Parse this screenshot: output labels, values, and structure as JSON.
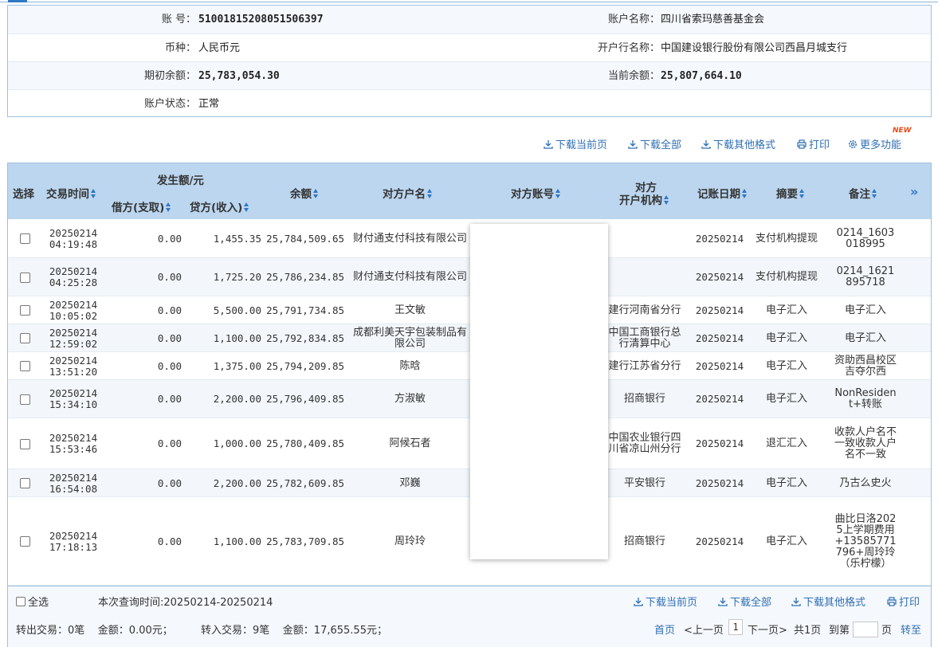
{
  "account": {
    "no_label": "账      号：",
    "no": "51001815208051506397",
    "name_label": "账户名称：",
    "name": "四川省索玛慈善基金会",
    "currency_label": "币种：",
    "currency": "人民币元",
    "bank_label": "开户行名称：",
    "bank": "中国建设银行股份有限公司西昌月城支行",
    "open_label": "期初余额：",
    "open_balance": "25,783,054.30",
    "current_label": "当前余额：",
    "current_balance": "25,807,664.10",
    "status_label": "账户状态：",
    "status": "正常"
  },
  "toolbar": {
    "new_badge": "NEW",
    "download_page": "下载当前页",
    "download_all": "下载全部",
    "download_other": "下载其他格式",
    "print": "打印",
    "more": "更多功能"
  },
  "table": {
    "headers": {
      "select": "选择",
      "time": "交易时间",
      "amount_group": "发生额/元",
      "debit": "借方(支取)",
      "credit": "贷方(收入)",
      "balance": "余额",
      "cp_name": "对方户名",
      "cp_account": "对方账号",
      "cp_bank_1": "对方",
      "cp_bank_2": "开户机构",
      "post_date": "记账日期",
      "summary": "摘要",
      "remark": "备注",
      "more_cols": "»"
    },
    "rows": [
      {
        "date": "20250214",
        "time": "04:19:48",
        "debit": "0.00",
        "credit": "1,455.35",
        "balance": "25,784,509.65",
        "cp_name": "财付通支付科技有限公司",
        "cp_bank": "",
        "post_date": "20250214",
        "summary": "支付机构提现",
        "remark": "0214_1603018995"
      },
      {
        "date": "20250214",
        "time": "04:25:28",
        "debit": "0.00",
        "credit": "1,725.20",
        "balance": "25,786,234.85",
        "cp_name": "财付通支付科技有限公司",
        "cp_bank": "",
        "post_date": "20250214",
        "summary": "支付机构提现",
        "remark": "0214_1621895718"
      },
      {
        "date": "20250214",
        "time": "10:05:02",
        "debit": "0.00",
        "credit": "5,500.00",
        "balance": "25,791,734.85",
        "cp_name": "王文敏",
        "cp_bank": "建行河南省分行",
        "post_date": "20250214",
        "summary": "电子汇入",
        "remark": "电子汇入"
      },
      {
        "date": "20250214",
        "time": "12:59:02",
        "debit": "0.00",
        "credit": "1,100.00",
        "balance": "25,792,834.85",
        "cp_name": "成都利美天宇包装制品有限公司",
        "cp_bank": "中国工商银行总行清算中心",
        "post_date": "20250214",
        "summary": "电子汇入",
        "remark": "电子汇入"
      },
      {
        "date": "20250214",
        "time": "13:51:20",
        "debit": "0.00",
        "credit": "1,375.00",
        "balance": "25,794,209.85",
        "cp_name": "陈晗",
        "cp_bank": "建行江苏省分行",
        "post_date": "20250214",
        "summary": "电子汇入",
        "remark": "资助西昌校区吉夺尔西"
      },
      {
        "date": "20250214",
        "time": "15:34:10",
        "debit": "0.00",
        "credit": "2,200.00",
        "balance": "25,796,409.85",
        "cp_name": "方淑敏",
        "cp_bank": "招商银行",
        "post_date": "20250214",
        "summary": "电子汇入",
        "remark": "NonResident+转账"
      },
      {
        "date": "20250214",
        "time": "15:53:46",
        "debit": "0.00",
        "credit": "1,000.00",
        "balance": "25,780,409.85",
        "cp_name": "阿候石者",
        "cp_bank": "中国农业银行四川省凉山州分行",
        "post_date": "20250214",
        "summary": "退汇汇入",
        "remark": "收款人户名不一致收款人户名不一致"
      },
      {
        "date": "20250214",
        "time": "16:54:08",
        "debit": "0.00",
        "credit": "2,200.00",
        "balance": "25,782,609.85",
        "cp_name": "邓巍",
        "cp_bank": "平安银行",
        "post_date": "20250214",
        "summary": "电子汇入",
        "remark": "乃古么史火"
      },
      {
        "date": "20250214",
        "time": "17:18:13",
        "debit": "0.00",
        "credit": "1,100.00",
        "balance": "25,783,709.85",
        "cp_name": "周玲玲",
        "cp_bank": "招商银行",
        "post_date": "20250214",
        "summary": "电子汇入",
        "remark": "曲比日洛2025上学期费用+13585771796+周玲玲（乐柠檬）"
      }
    ]
  },
  "footer": {
    "select_all": "全选",
    "query_time": "本次查询时间:20250214-20250214",
    "download_page": "下载当前页",
    "download_all": "下载全部",
    "download_other": "下载其他格式",
    "print": "打印",
    "out_summary": "转出交易：0笔    金额：0.00元；",
    "in_summary": "转入交易：9笔    金额：17,655.55元；",
    "first": "首页",
    "prev": "<上一页",
    "page": "1",
    "next": "下一页>",
    "total": "共1页",
    "goto_label": "到第",
    "page_unit": "页",
    "go": "转至"
  }
}
